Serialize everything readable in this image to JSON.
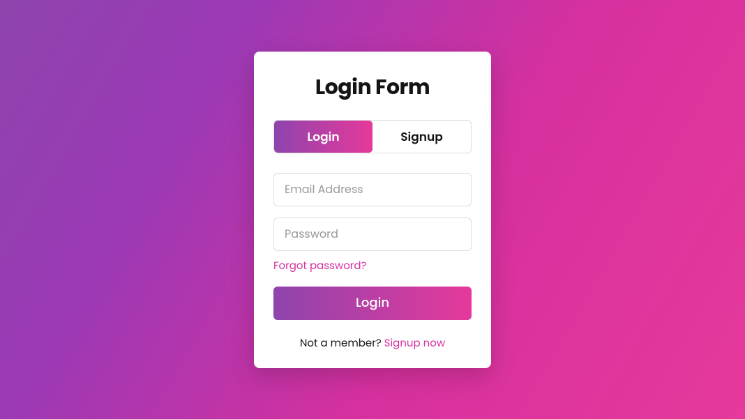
{
  "title": "Login Form",
  "tabs": {
    "login": "Login",
    "signup": "Signup"
  },
  "fields": {
    "email_placeholder": "Email Address",
    "password_placeholder": "Password"
  },
  "links": {
    "forgot": "Forgot password?",
    "signup": "Signup now"
  },
  "buttons": {
    "submit": "Login"
  },
  "footer": {
    "prefix": "Not a member? "
  }
}
